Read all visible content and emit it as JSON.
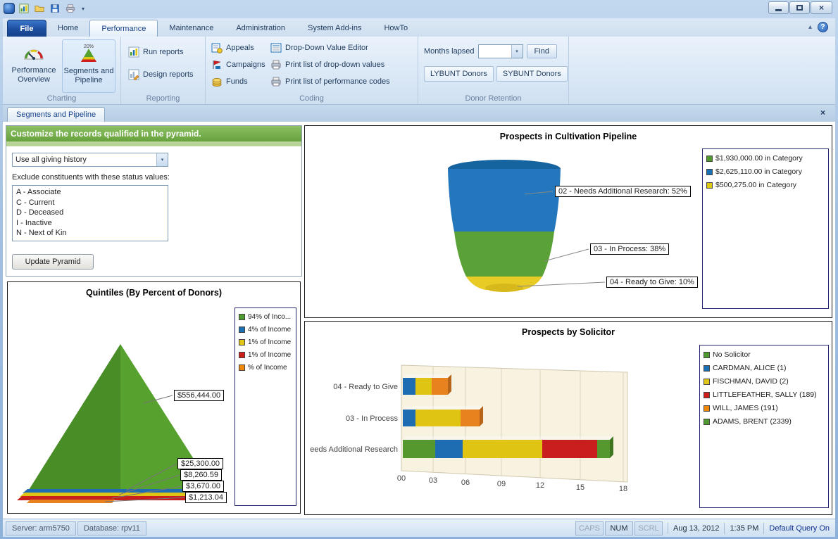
{
  "icons": {
    "close": "×",
    "doc_tab_close": "×",
    "qat_dropdown": "▾",
    "combo_arrow": "▾",
    "ribbon_collapse": "▴",
    "help": "?",
    "segments_badge": "20%"
  },
  "tabs": {
    "file": "File",
    "items": [
      "Home",
      "Performance",
      "Maintenance",
      "Administration",
      "System Add-ins",
      "HowTo"
    ],
    "active": "Performance"
  },
  "ribbon": {
    "charting": {
      "label": "Charting",
      "performance_overview": "Performance Overview",
      "segments_pipeline": "Segments and Pipeline"
    },
    "reporting": {
      "label": "Reporting",
      "run_reports": "Run reports",
      "design_reports": "Design reports"
    },
    "coding": {
      "label": "Coding",
      "appeals": "Appeals",
      "campaigns": "Campaigns",
      "funds": "Funds",
      "dropdown_editor": "Drop-Down Value Editor",
      "print_dropdown": "Print list of drop-down values",
      "print_codes": "Print list of performance codes"
    },
    "donor_retention": {
      "label": "Donor Retention",
      "months_lapsed": "Months lapsed",
      "find": "Find",
      "lybunt": "LYBUNT Donors",
      "sybunt": "SYBUNT Donors"
    }
  },
  "doc_tab": {
    "label": "Segments and Pipeline"
  },
  "customize_panel": {
    "header": "Customize the records qualified in the pyramid.",
    "history_value": "Use all giving history",
    "exclude_label": "Exclude constituents with these status values:",
    "status_values": [
      "A - Associate",
      "C - Current",
      "D - Deceased",
      "I - Inactive",
      "N - Next of Kin"
    ],
    "update_button": "Update Pyramid"
  },
  "chart_data": [
    {
      "type": "pyramid",
      "title": "Quintiles (By Percent of Donors)",
      "legend_position": "right",
      "segments": [
        {
          "legend": "94% of Inco...",
          "color": "#4e9a2e",
          "callout": "$556,444.00"
        },
        {
          "legend": "4% of Income",
          "color": "#1a6fb5",
          "callout": "$25,300.00"
        },
        {
          "legend": "1% of Income",
          "color": "#e1c715",
          "callout": "$8,260.59"
        },
        {
          "legend": "1% of Income",
          "color": "#cf1d1d",
          "callout": "$3,670.00"
        },
        {
          "legend": "% of Income",
          "color": "#ef8807",
          "callout": "$1,213.04"
        }
      ]
    },
    {
      "type": "funnel",
      "title": "Prospects in Cultivation Pipeline",
      "legend_position": "right",
      "segments": [
        {
          "callout": "02 - Needs Additional Research: 52%",
          "pct": 52,
          "color": "#2477bd"
        },
        {
          "callout": "03 - In Process: 38%",
          "pct": 38,
          "color": "#5aa237"
        },
        {
          "callout": "04 - Ready to Give: 10%",
          "pct": 10,
          "color": "#e9cb26"
        }
      ],
      "legend": [
        {
          "label": "$1,930,000.00 in Category",
          "color": "#4e9a2e"
        },
        {
          "label": "$2,625,110.00 in Category",
          "color": "#1a6fb5"
        },
        {
          "label": "$500,275.00 in Category",
          "color": "#e1c715"
        }
      ]
    },
    {
      "type": "bar",
      "orientation": "horizontal-stacked-3d",
      "title": "Prospects by Solicitor",
      "categories": [
        "04 - Ready to Give",
        "03 - In Process",
        "eeds Additional Research"
      ],
      "x_ticks": [
        "00",
        "03",
        "06",
        "09",
        "12",
        "15",
        "18"
      ],
      "xlim": [
        0,
        18
      ],
      "grid": true,
      "stacks": [
        {
          "category_index": 0,
          "segments": [
            {
              "color": "#1e6db2",
              "value": 1.0
            },
            {
              "color": "#dfc414",
              "value": 1.3
            },
            {
              "color": "#e8821e",
              "value": 1.2
            }
          ]
        },
        {
          "category_index": 1,
          "segments": [
            {
              "color": "#1e6db2",
              "value": 1.0
            },
            {
              "color": "#dfc414",
              "value": 3.6
            },
            {
              "color": "#e8821e",
              "value": 1.5
            }
          ]
        },
        {
          "category_index": 2,
          "segments": [
            {
              "color": "#55982e",
              "value": 2.6
            },
            {
              "color": "#1e6db2",
              "value": 2.2
            },
            {
              "color": "#dfc414",
              "value": 6.4
            },
            {
              "color": "#c81e1e",
              "value": 4.4
            },
            {
              "color": "#55982e",
              "value": 1.0
            }
          ]
        }
      ],
      "legend": [
        {
          "label": "No Solicitor",
          "color": "#4e9a2e"
        },
        {
          "label": "CARDMAN, ALICE (1)",
          "color": "#1a6fb5"
        },
        {
          "label": "FISCHMAN, DAVID (2)",
          "color": "#e1c715"
        },
        {
          "label": "LITTLEFEATHER, SALLY (189)",
          "color": "#cf1d1d"
        },
        {
          "label": "WILL, JAMES (191)",
          "color": "#ef8807"
        },
        {
          "label": "ADAMS, BRENT (2339)",
          "color": "#4e9a2e"
        }
      ]
    }
  ],
  "statusbar": {
    "server": "Server: arm5750",
    "database": "Database: rpv11",
    "caps": "CAPS",
    "num": "NUM",
    "scrl": "SCRL",
    "date": "Aug 13, 2012",
    "time": "1:35 PM",
    "query_mode": "Default Query On"
  }
}
